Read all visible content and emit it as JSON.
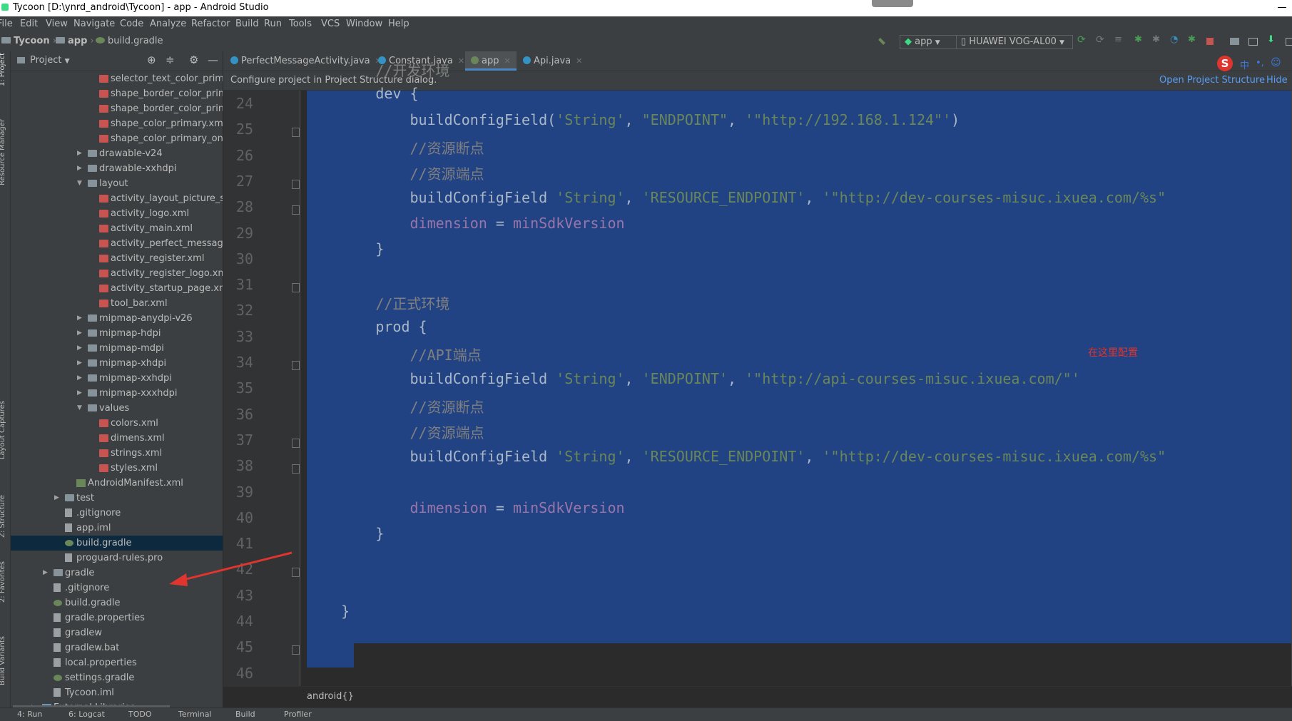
{
  "window": {
    "title": "Tycoon [D:\\ynrd_android\\Tycoon] - app - Android Studio"
  },
  "menu": [
    "File",
    "Edit",
    "View",
    "Navigate",
    "Code",
    "Analyze",
    "Refactor",
    "Build",
    "Run",
    "Tools",
    "VCS",
    "Window",
    "Help"
  ],
  "breadcrumb": {
    "project": "Tycoon",
    "module": "app",
    "file": "build.gradle"
  },
  "toolbar": {
    "run_config": "app",
    "device": "HUAWEI VOG-AL00"
  },
  "project_panel": {
    "title": "Project"
  },
  "side_labels": {
    "project": "1: Project",
    "resource_manager": "Resource Manager",
    "layout_captures": "Layout Captures",
    "structure": "Z: Structure",
    "favorites": "2: Favorites",
    "build_variants": "Build Variants"
  },
  "tree": [
    {
      "label": "selector_text_color_primar",
      "icon": "xml",
      "indent": 2
    },
    {
      "label": "shape_border_color_prima",
      "icon": "xml",
      "indent": 2
    },
    {
      "label": "shape_border_color_prima",
      "icon": "xml",
      "indent": 2
    },
    {
      "label": "shape_color_primary.xml",
      "icon": "xml",
      "indent": 2
    },
    {
      "label": "shape_color_primary_oncli",
      "icon": "xml",
      "indent": 2
    },
    {
      "label": "drawable-v24",
      "icon": "folder",
      "indent": 1,
      "arrow": "right"
    },
    {
      "label": "drawable-xxhdpi",
      "icon": "folder",
      "indent": 1,
      "arrow": "right"
    },
    {
      "label": "layout",
      "icon": "folder",
      "indent": 1,
      "arrow": "down"
    },
    {
      "label": "activity_layout_picture_sele",
      "icon": "xml",
      "indent": 2
    },
    {
      "label": "activity_logo.xml",
      "icon": "xml",
      "indent": 2
    },
    {
      "label": "activity_main.xml",
      "icon": "xml",
      "indent": 2
    },
    {
      "label": "activity_perfect_message.x",
      "icon": "xml",
      "indent": 2
    },
    {
      "label": "activity_register.xml",
      "icon": "xml",
      "indent": 2
    },
    {
      "label": "activity_register_logo.xml",
      "icon": "xml",
      "indent": 2
    },
    {
      "label": "activity_startup_page.xml",
      "icon": "xml",
      "indent": 2
    },
    {
      "label": "tool_bar.xml",
      "icon": "xml",
      "indent": 2
    },
    {
      "label": "mipmap-anydpi-v26",
      "icon": "folder",
      "indent": 1,
      "arrow": "right"
    },
    {
      "label": "mipmap-hdpi",
      "icon": "folder",
      "indent": 1,
      "arrow": "right"
    },
    {
      "label": "mipmap-mdpi",
      "icon": "folder",
      "indent": 1,
      "arrow": "right"
    },
    {
      "label": "mipmap-xhdpi",
      "icon": "folder",
      "indent": 1,
      "arrow": "right"
    },
    {
      "label": "mipmap-xxhdpi",
      "icon": "folder",
      "indent": 1,
      "arrow": "right"
    },
    {
      "label": "mipmap-xxxhdpi",
      "icon": "folder",
      "indent": 1,
      "arrow": "right"
    },
    {
      "label": "values",
      "icon": "folder",
      "indent": 1,
      "arrow": "down"
    },
    {
      "label": "colors.xml",
      "icon": "xml",
      "indent": 2
    },
    {
      "label": "dimens.xml",
      "icon": "xml",
      "indent": 2
    },
    {
      "label": "strings.xml",
      "icon": "xml",
      "indent": 2
    },
    {
      "label": "styles.xml",
      "icon": "xml",
      "indent": 2
    },
    {
      "label": "AndroidManifest.xml",
      "icon": "manifest",
      "indent": 0
    },
    {
      "label": "test",
      "icon": "folder",
      "indent": -1,
      "arrow": "right"
    },
    {
      "label": ".gitignore",
      "icon": "file",
      "indent": -1
    },
    {
      "label": "app.iml",
      "icon": "file",
      "indent": -1
    },
    {
      "label": "build.gradle",
      "icon": "gradle",
      "indent": -1,
      "selected": true
    },
    {
      "label": "proguard-rules.pro",
      "icon": "file",
      "indent": -1
    },
    {
      "label": "gradle",
      "icon": "folder",
      "indent": -2,
      "arrow": "right"
    },
    {
      "label": ".gitignore",
      "icon": "file",
      "indent": -2
    },
    {
      "label": "build.gradle",
      "icon": "gradle",
      "indent": -2
    },
    {
      "label": "gradle.properties",
      "icon": "file",
      "indent": -2
    },
    {
      "label": "gradlew",
      "icon": "file",
      "indent": -2
    },
    {
      "label": "gradlew.bat",
      "icon": "file",
      "indent": -2
    },
    {
      "label": "local.properties",
      "icon": "file",
      "indent": -2
    },
    {
      "label": "settings.gradle",
      "icon": "gradle",
      "indent": -2
    },
    {
      "label": "Tycoon.iml",
      "icon": "file",
      "indent": -2
    },
    {
      "label": "External Libraries",
      "icon": "libs",
      "indent": -3,
      "arrow": "right"
    }
  ],
  "tabs": [
    {
      "label": "PerfectMessageActivity.java",
      "active": false
    },
    {
      "label": "Constant.java",
      "active": false
    },
    {
      "label": "app",
      "active": true
    },
    {
      "label": "Api.java",
      "active": false
    }
  ],
  "banner": {
    "message": "Configure project in Project Structure dialog.",
    "open_link": "Open Project Structure",
    "hide_link": "Hide"
  },
  "code": [
    {
      "n": "24",
      "indent": "        ",
      "parts": [
        {
          "t": "//开发环境",
          "k": "cmt"
        }
      ]
    },
    {
      "n": "25",
      "indent": "        ",
      "parts": [
        {
          "t": "dev {",
          "k": ""
        }
      ]
    },
    {
      "n": "26",
      "indent": "            ",
      "parts": [
        {
          "t": "buildConfigField(",
          "k": ""
        },
        {
          "t": "'String'",
          "k": "str"
        },
        {
          "t": ", ",
          "k": ""
        },
        {
          "t": "\"ENDPOINT\"",
          "k": "str"
        },
        {
          "t": ", ",
          "k": ""
        },
        {
          "t": "'\"http://192.168.1.124\"'",
          "k": "str"
        },
        {
          "t": ")",
          "k": ""
        }
      ]
    },
    {
      "n": "27",
      "indent": "            ",
      "parts": [
        {
          "t": "//资源断点",
          "k": "cmt"
        }
      ]
    },
    {
      "n": "28",
      "indent": "            ",
      "parts": [
        {
          "t": "//资源端点",
          "k": "cmt"
        }
      ]
    },
    {
      "n": "29",
      "indent": "            ",
      "parts": [
        {
          "t": "buildConfigField ",
          "k": ""
        },
        {
          "t": "'String'",
          "k": "str"
        },
        {
          "t": ", ",
          "k": ""
        },
        {
          "t": "'RESOURCE_ENDPOINT'",
          "k": "str"
        },
        {
          "t": ", ",
          "k": ""
        },
        {
          "t": "'\"http://dev-courses-misuc.ixuea.com/%s\"",
          "k": "str"
        }
      ]
    },
    {
      "n": "30",
      "indent": "            ",
      "parts": [
        {
          "t": "dimension",
          "k": "fld"
        },
        {
          "t": " = ",
          "k": ""
        },
        {
          "t": "minSdkVersion",
          "k": "fld"
        }
      ]
    },
    {
      "n": "31",
      "indent": "        ",
      "parts": [
        {
          "t": "}",
          "k": ""
        }
      ]
    },
    {
      "n": "32",
      "indent": "",
      "parts": []
    },
    {
      "n": "33",
      "indent": "        ",
      "parts": [
        {
          "t": "//正式环境",
          "k": "cmt"
        }
      ]
    },
    {
      "n": "34",
      "indent": "        ",
      "parts": [
        {
          "t": "prod {",
          "k": ""
        }
      ]
    },
    {
      "n": "35",
      "indent": "            ",
      "parts": [
        {
          "t": "//API端点",
          "k": "cmt"
        }
      ]
    },
    {
      "n": "36",
      "indent": "            ",
      "parts": [
        {
          "t": "buildConfigField ",
          "k": ""
        },
        {
          "t": "'String'",
          "k": "str"
        },
        {
          "t": ", ",
          "k": ""
        },
        {
          "t": "'ENDPOINT'",
          "k": "str"
        },
        {
          "t": ", ",
          "k": ""
        },
        {
          "t": "'\"http://api-courses-misuc.ixuea.com/\"'",
          "k": "str"
        }
      ]
    },
    {
      "n": "37",
      "indent": "            ",
      "parts": [
        {
          "t": "//资源断点",
          "k": "cmt"
        }
      ]
    },
    {
      "n": "38",
      "indent": "            ",
      "parts": [
        {
          "t": "//资源端点",
          "k": "cmt"
        }
      ]
    },
    {
      "n": "39",
      "indent": "            ",
      "parts": [
        {
          "t": "buildConfigField ",
          "k": ""
        },
        {
          "t": "'String'",
          "k": "str"
        },
        {
          "t": ", ",
          "k": ""
        },
        {
          "t": "'RESOURCE_ENDPOINT'",
          "k": "str"
        },
        {
          "t": ", ",
          "k": ""
        },
        {
          "t": "'\"http://dev-courses-misuc.ixuea.com/%s\"",
          "k": "str"
        }
      ]
    },
    {
      "n": "40",
      "indent": "",
      "parts": []
    },
    {
      "n": "41",
      "indent": "            ",
      "parts": [
        {
          "t": "dimension",
          "k": "fld"
        },
        {
          "t": " = ",
          "k": ""
        },
        {
          "t": "minSdkVersion",
          "k": "fld"
        }
      ]
    },
    {
      "n": "42",
      "indent": "        ",
      "parts": [
        {
          "t": "}",
          "k": ""
        }
      ]
    },
    {
      "n": "43",
      "indent": "",
      "parts": []
    },
    {
      "n": "44",
      "indent": "",
      "parts": []
    },
    {
      "n": "45",
      "indent": "    ",
      "parts": [
        {
          "t": "}",
          "k": ""
        }
      ]
    },
    {
      "n": "46",
      "indent": "",
      "parts": []
    }
  ],
  "annotation": "在这里配置",
  "status_breadcrumb": "android{}",
  "bottom_tools": [
    "4: Run",
    "6: Logcat",
    "TODO",
    "Terminal",
    "Build",
    "Profiler"
  ],
  "colors": {
    "selection": "#214283",
    "comment": "#808080",
    "string": "#6a8759",
    "field": "#9876aa",
    "annotation": "#e0352f"
  }
}
